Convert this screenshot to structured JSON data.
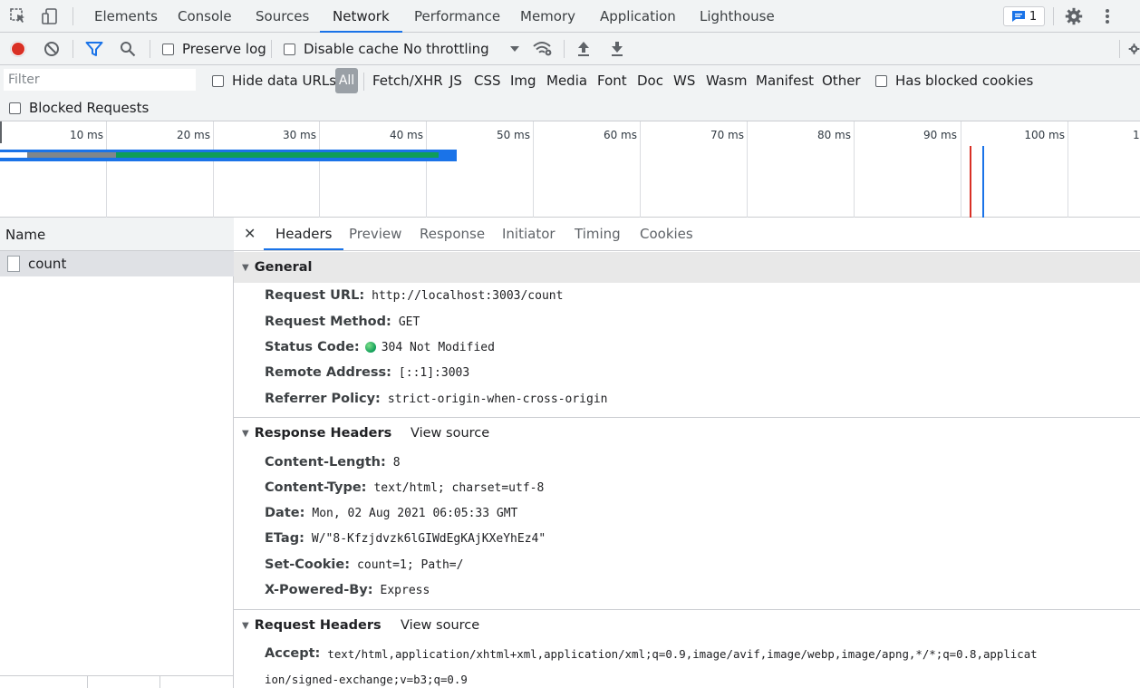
{
  "top_tabs": [
    "Elements",
    "Console",
    "Sources",
    "Network",
    "Performance",
    "Memory",
    "Application",
    "Lighthouse"
  ],
  "active_top_tab": "Network",
  "issues_count": "1",
  "toolbar": {
    "preserve_log": "Preserve log",
    "disable_cache": "Disable cache",
    "throttling": "No throttling"
  },
  "filter": {
    "placeholder": "Filter",
    "hide_data_urls": "Hide data URLs",
    "types": [
      "All",
      "Fetch/XHR",
      "JS",
      "CSS",
      "Img",
      "Media",
      "Font",
      "Doc",
      "WS",
      "Wasm",
      "Manifest",
      "Other"
    ],
    "has_blocked_cookies": "Has blocked cookies",
    "blocked_requests": "Blocked Requests"
  },
  "timeline": {
    "ticks": [
      "10 ms",
      "20 ms",
      "30 ms",
      "40 ms",
      "50 ms",
      "60 ms",
      "70 ms",
      "80 ms",
      "90 ms",
      "100 ms",
      "1"
    ]
  },
  "name_pane": {
    "header": "Name",
    "rows": [
      "count"
    ]
  },
  "detail_tabs": [
    "Headers",
    "Preview",
    "Response",
    "Initiator",
    "Timing",
    "Cookies"
  ],
  "active_detail_tab": "Headers",
  "general": {
    "title": "General",
    "rows": [
      {
        "key": "Request URL:",
        "value": "http://localhost:3003/count"
      },
      {
        "key": "Request Method:",
        "value": "GET"
      },
      {
        "key": "Status Code:",
        "value": "304 Not Modified"
      },
      {
        "key": "Remote Address:",
        "value": "[::1]:3003"
      },
      {
        "key": "Referrer Policy:",
        "value": "strict-origin-when-cross-origin"
      }
    ]
  },
  "response_headers": {
    "title": "Response Headers",
    "view_source": "View source",
    "rows": [
      {
        "key": "Content-Length:",
        "value": "8"
      },
      {
        "key": "Content-Type:",
        "value": "text/html; charset=utf-8"
      },
      {
        "key": "Date:",
        "value": "Mon, 02 Aug 2021 06:05:33 GMT"
      },
      {
        "key": "ETag:",
        "value": "W/\"8-Kfzjdvzk6lGIWdEgKAjKXeYhEz4\""
      },
      {
        "key": "Set-Cookie:",
        "value": "count=1; Path=/"
      },
      {
        "key": "X-Powered-By:",
        "value": "Express"
      }
    ]
  },
  "request_headers": {
    "title": "Request Headers",
    "view_source": "View source",
    "accept_key": "Accept:",
    "accept_value_line1": "text/html,application/xhtml+xml,application/xml;q=0.9,image/avif,image/webp,image/apng,*/*;q=0.8,applicat",
    "accept_value_line2": "ion/signed-exchange;v=b3;q=0.9"
  },
  "colors": {
    "accent": "#1a73e8",
    "record": "#d93025",
    "status_ok": "#0f9d58"
  }
}
